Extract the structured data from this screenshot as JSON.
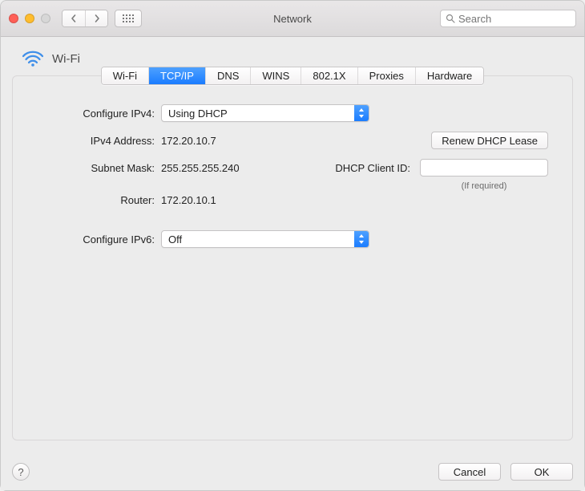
{
  "window": {
    "title": "Network"
  },
  "toolbar": {
    "search_placeholder": "Search"
  },
  "heading": {
    "title": "Wi-Fi"
  },
  "tabs": [
    {
      "label": "Wi-Fi",
      "active": false
    },
    {
      "label": "TCP/IP",
      "active": true
    },
    {
      "label": "DNS",
      "active": false
    },
    {
      "label": "WINS",
      "active": false
    },
    {
      "label": "802.1X",
      "active": false
    },
    {
      "label": "Proxies",
      "active": false
    },
    {
      "label": "Hardware",
      "active": false
    }
  ],
  "tcpip": {
    "configure_ipv4_label": "Configure IPv4:",
    "configure_ipv4_value": "Using DHCP",
    "ipv4_address_label": "IPv4 Address:",
    "ipv4_address_value": "172.20.10.7",
    "subnet_mask_label": "Subnet Mask:",
    "subnet_mask_value": "255.255.255.240",
    "router_label": "Router:",
    "router_value": "172.20.10.1",
    "renew_lease_label": "Renew DHCP Lease",
    "dhcp_client_id_label": "DHCP Client ID:",
    "dhcp_client_id_value": "",
    "dhcp_client_id_hint": "(If required)",
    "configure_ipv6_label": "Configure IPv6:",
    "configure_ipv6_value": "Off"
  },
  "footer": {
    "help_label": "?",
    "cancel_label": "Cancel",
    "ok_label": "OK"
  }
}
